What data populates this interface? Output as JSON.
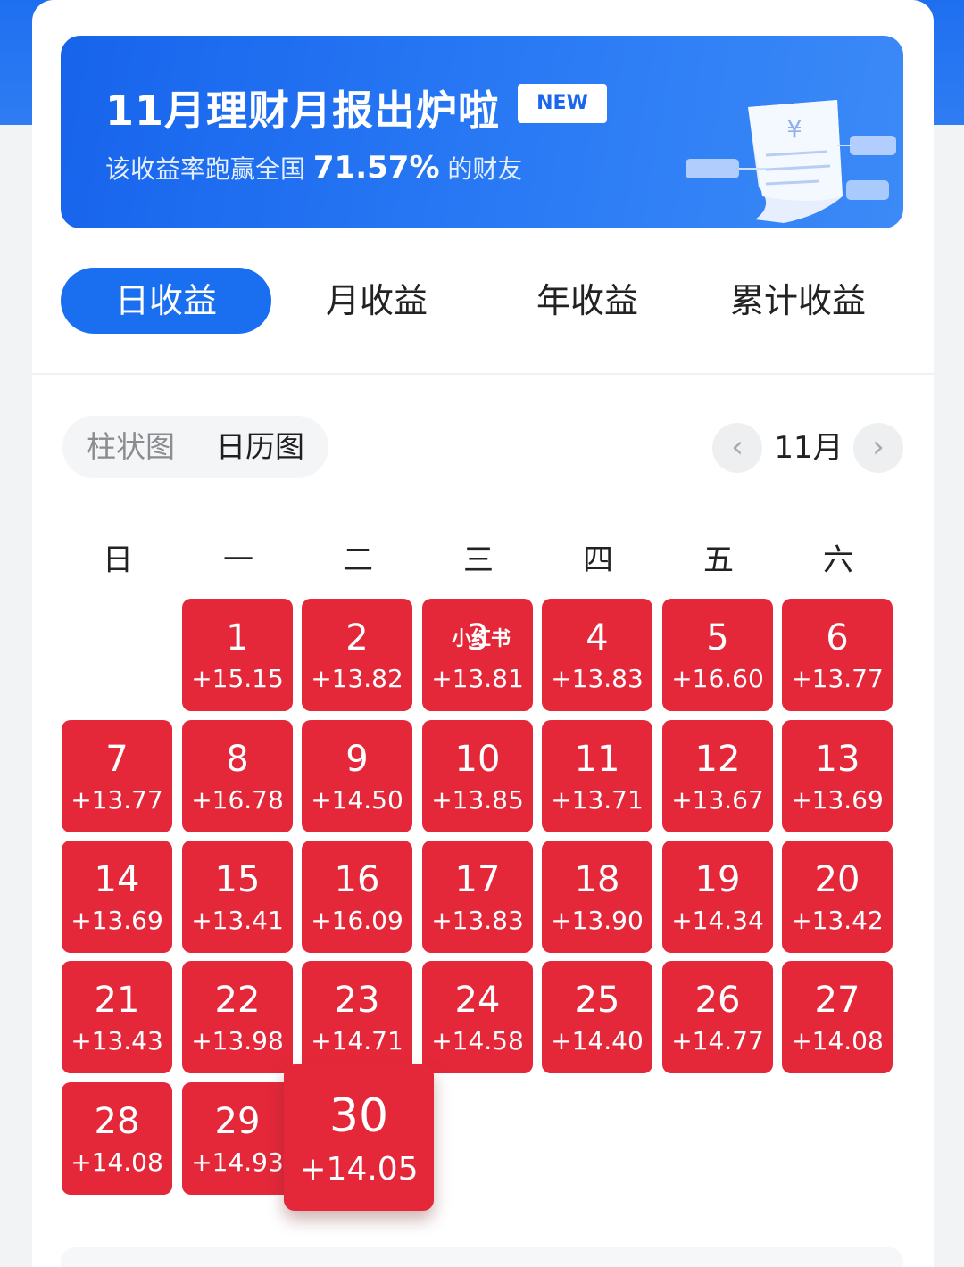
{
  "banner": {
    "title": "11月理财月报出炉啦",
    "badge": "NEW",
    "subtitle_prefix": "该收益率跑赢全国 ",
    "subtitle_pct": "71.57%",
    "subtitle_suffix": " 的财友",
    "illustration_symbol": "¥"
  },
  "tabs": [
    "日收益",
    "月收益",
    "年收益",
    "累计收益"
  ],
  "active_tab": "日收益",
  "view_toggle": {
    "options": [
      "柱状图",
      "日历图"
    ],
    "selected": "日历图"
  },
  "month_nav": {
    "prev_icon": "chevron-left-icon",
    "label": "11月",
    "next_icon": "chevron-right-icon"
  },
  "weekdays": [
    "日",
    "一",
    "二",
    "三",
    "四",
    "五",
    "六"
  ],
  "calendar": {
    "start_weekday_index": 1,
    "selected_day": 30,
    "cell_color": "#e4283a",
    "days": [
      {
        "day": "1",
        "value": "+15.15"
      },
      {
        "day": "2",
        "value": "+13.82"
      },
      {
        "day": "3",
        "value": "+13.81"
      },
      {
        "day": "4",
        "value": "+13.83"
      },
      {
        "day": "5",
        "value": "+16.60"
      },
      {
        "day": "6",
        "value": "+13.77"
      },
      {
        "day": "7",
        "value": "+13.77"
      },
      {
        "day": "8",
        "value": "+16.78"
      },
      {
        "day": "9",
        "value": "+14.50"
      },
      {
        "day": "10",
        "value": "+13.85"
      },
      {
        "day": "11",
        "value": "+13.71"
      },
      {
        "day": "12",
        "value": "+13.67"
      },
      {
        "day": "13",
        "value": "+13.69"
      },
      {
        "day": "14",
        "value": "+13.69"
      },
      {
        "day": "15",
        "value": "+13.41"
      },
      {
        "day": "16",
        "value": "+16.09"
      },
      {
        "day": "17",
        "value": "+13.83"
      },
      {
        "day": "18",
        "value": "+13.90"
      },
      {
        "day": "19",
        "value": "+14.34"
      },
      {
        "day": "20",
        "value": "+13.42"
      },
      {
        "day": "21",
        "value": "+13.43"
      },
      {
        "day": "22",
        "value": "+13.98"
      },
      {
        "day": "23",
        "value": "+14.71"
      },
      {
        "day": "24",
        "value": "+14.58"
      },
      {
        "day": "25",
        "value": "+14.40"
      },
      {
        "day": "26",
        "value": "+14.77"
      },
      {
        "day": "27",
        "value": "+14.08"
      },
      {
        "day": "28",
        "value": "+14.08"
      },
      {
        "day": "29",
        "value": "+14.93"
      },
      {
        "day": "30",
        "value": "+14.05"
      }
    ]
  },
  "watermark": "小红书",
  "colors": {
    "brand_blue": "#1a6ff0",
    "cell_red": "#e4283a"
  }
}
